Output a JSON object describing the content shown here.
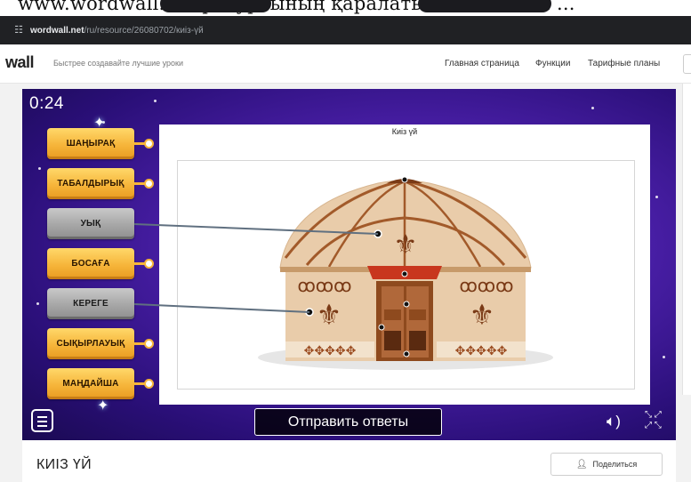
{
  "top_caption": "www.wordwall.net ресурсының қаралатын Бекітілген ...",
  "browser": {
    "url_host": "wordwall.net",
    "url_path": "/ru/resource/26080702/киіз-үй"
  },
  "site": {
    "logo": "wall",
    "tagline": "Быстрее создавайте лучшие уроки",
    "nav": [
      "Главная страница",
      "Функции",
      "Тарифные планы"
    ]
  },
  "game": {
    "timer": "0:24",
    "image_title": "Киіз үй",
    "labels": [
      {
        "text": "ШАҢЫРАҚ",
        "placed": false
      },
      {
        "text": "ТАБАЛДЫРЫҚ",
        "placed": false
      },
      {
        "text": "УЫҚ",
        "placed": true
      },
      {
        "text": "БОСАҒА",
        "placed": false
      },
      {
        "text": "КЕРЕГЕ",
        "placed": true
      },
      {
        "text": "СЫҚЫРЛАУЫҚ",
        "placed": false
      },
      {
        "text": "МАҢДАЙША",
        "placed": false
      }
    ],
    "submit_label": "Отправить ответы"
  },
  "activity": {
    "title": "КИІЗ ҮЙ",
    "share_label": "Поделиться"
  },
  "colors": {
    "label_gold": "#f6b53a",
    "label_placed": "#a6a6a6",
    "game_purple": "#4a1fa8",
    "connector": "#607080",
    "yurt_felt": "#e9ccaa",
    "yurt_wood": "#a25a2a"
  },
  "icons": {
    "site_info": "tune-icon",
    "menu": "menu-icon",
    "sound": "speaker-icon",
    "fullscreen": "fullscreen-icon",
    "share": "share-person-icon"
  }
}
